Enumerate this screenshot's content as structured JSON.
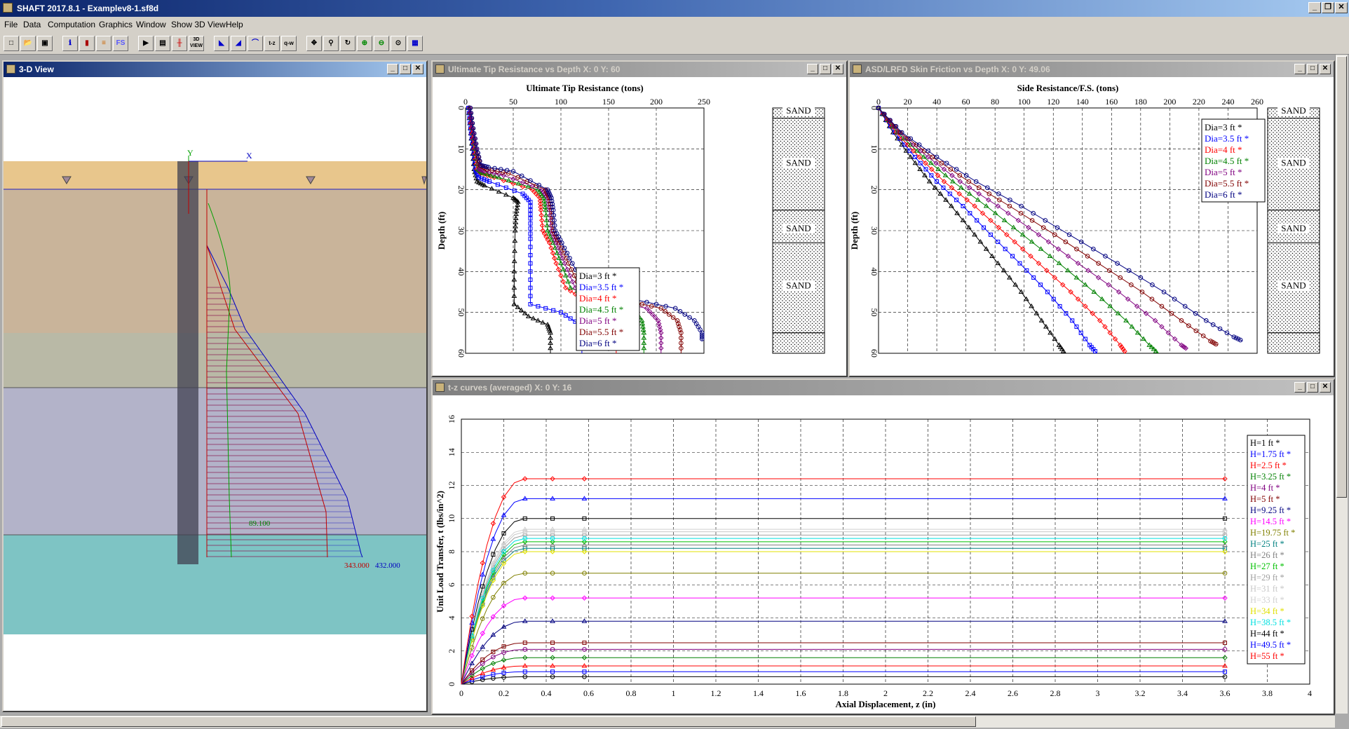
{
  "app": {
    "title": "SHAFT 2017.8.1 - Examplev8-1.sf8d"
  },
  "menu": [
    "File",
    "Data",
    "Computation",
    "Graphics",
    "Window",
    "Show 3D View",
    "Help"
  ],
  "toolbar": {
    "buttons": [
      "new",
      "open",
      "save",
      "color",
      "sep",
      "fs",
      "run",
      "list",
      "pile",
      "3D",
      "icon",
      "icon",
      "icon",
      "icon",
      "t-z",
      "icon",
      "icon",
      "icon",
      "icon",
      "icon",
      "icon",
      "icon",
      "icon"
    ],
    "view3d_label": "3D VIEW",
    "fs_label": "FS"
  },
  "view3d": {
    "title": "3-D View",
    "axis_y": "Y",
    "axis_x": "X",
    "label_mid": "89.100",
    "label_a": "343.000",
    "label_b": "432.000",
    "layers": [
      {
        "color": "#e8c68c"
      },
      {
        "color": "#c9b49a"
      },
      {
        "color": "#b9b9a6"
      },
      {
        "color": "#b3b3c9"
      },
      {
        "color": "#7ec4c4"
      }
    ]
  },
  "tip": {
    "title": "Ultimate Tip Resistance vs Depth X: 0 Y: 60",
    "chart_data": {
      "type": "line",
      "title": "Ultimate Tip Resistance  (tons)",
      "xlabel": "",
      "ylabel": "Depth (ft)",
      "xlim": [
        0,
        250
      ],
      "ylim": [
        0,
        60
      ],
      "xticks": [
        "0",
        "50",
        "100",
        "150",
        "200",
        "250"
      ],
      "yticks": [
        "0",
        "10",
        "20",
        "30",
        "40",
        "50",
        "60"
      ],
      "series": [
        {
          "name": "Dia=3 ft *",
          "color": "#000000",
          "points": [
            [
              3,
              0
            ],
            [
              5,
              5
            ],
            [
              7,
              10
            ],
            [
              9,
              15
            ],
            [
              12,
              18
            ],
            [
              20,
              19
            ],
            [
              50,
              22
            ],
            [
              55,
              23
            ],
            [
              53,
              26
            ],
            [
              52,
              30
            ],
            [
              51,
              40
            ],
            [
              51,
              48
            ],
            [
              66,
              51
            ],
            [
              86,
              53
            ],
            [
              89,
              55
            ],
            [
              89,
              60
            ]
          ]
        },
        {
          "name": "Dia=3.5 ft *",
          "color": "#0000ff",
          "points": [
            [
              3,
              0
            ],
            [
              5,
              5
            ],
            [
              8,
              10
            ],
            [
              10,
              15
            ],
            [
              14,
              17
            ],
            [
              25,
              18
            ],
            [
              60,
              21
            ],
            [
              68,
              23
            ],
            [
              68,
              27
            ],
            [
              68,
              32
            ],
            [
              68,
              40
            ],
            [
              68,
              48
            ],
            [
              100,
              50
            ],
            [
              120,
              53
            ],
            [
              122,
              55
            ],
            [
              122,
              60
            ]
          ]
        },
        {
          "name": "Dia=4 ft *",
          "color": "#ff0000",
          "points": [
            [
              4,
              0
            ],
            [
              6,
              5
            ],
            [
              9,
              10
            ],
            [
              12,
              15
            ],
            [
              16,
              16
            ],
            [
              30,
              17
            ],
            [
              70,
              20
            ],
            [
              78,
              22
            ],
            [
              79,
              25
            ],
            [
              81,
              30
            ],
            [
              88,
              33
            ],
            [
              95,
              38
            ],
            [
              105,
              44
            ],
            [
              125,
              47
            ],
            [
              150,
              49
            ],
            [
              157,
              52
            ],
            [
              158,
              55
            ],
            [
              158,
              60
            ]
          ]
        },
        {
          "name": "Dia=4.5 ft *",
          "color": "#008000",
          "points": [
            [
              4,
              0
            ],
            [
              7,
              5
            ],
            [
              10,
              10
            ],
            [
              13,
              15
            ],
            [
              18,
              16
            ],
            [
              35,
              17
            ],
            [
              76,
              20
            ],
            [
              82,
              22
            ],
            [
              84,
              25
            ],
            [
              86,
              30
            ],
            [
              92,
              33
            ],
            [
              100,
              38
            ],
            [
              110,
              44
            ],
            [
              140,
              47
            ],
            [
              175,
              49
            ],
            [
              185,
              52
            ],
            [
              187,
              55
            ],
            [
              187,
              60
            ]
          ]
        },
        {
          "name": "Dia=5 ft *",
          "color": "#800080",
          "points": [
            [
              4,
              0
            ],
            [
              7,
              5
            ],
            [
              11,
              10
            ],
            [
              14,
              15
            ],
            [
              20,
              15.5
            ],
            [
              40,
              16.5
            ],
            [
              80,
              20
            ],
            [
              86,
              22
            ],
            [
              88,
              25
            ],
            [
              90,
              30
            ],
            [
              95,
              33
            ],
            [
              104,
              38
            ],
            [
              115,
              44
            ],
            [
              150,
              47
            ],
            [
              190,
              49
            ],
            [
              202,
              52
            ],
            [
              205,
              55
            ],
            [
              205,
              60
            ]
          ]
        },
        {
          "name": "Dia=5.5 ft *",
          "color": "#800000",
          "points": [
            [
              5,
              0
            ],
            [
              8,
              5
            ],
            [
              12,
              10
            ],
            [
              15,
              14
            ],
            [
              22,
              15
            ],
            [
              45,
              16
            ],
            [
              84,
              20
            ],
            [
              88,
              22
            ],
            [
              90,
              25
            ],
            [
              92,
              30
            ],
            [
              98,
              33
            ],
            [
              108,
              38
            ],
            [
              120,
              44
            ],
            [
              165,
              47
            ],
            [
              205,
              49
            ],
            [
              222,
              52
            ],
            [
              226,
              55
            ],
            [
              226,
              60
            ]
          ]
        },
        {
          "name": "Dia=6 ft *",
          "color": "#000080",
          "points": [
            [
              5,
              0
            ],
            [
              8,
              5
            ],
            [
              12,
              10
            ],
            [
              16,
              14
            ],
            [
              24,
              14.5
            ],
            [
              50,
              15.5
            ],
            [
              86,
              20
            ],
            [
              90,
              22
            ],
            [
              92,
              25
            ],
            [
              94,
              30
            ],
            [
              101,
              33
            ],
            [
              112,
              38
            ],
            [
              126,
              44
            ],
            [
              180,
              47
            ],
            [
              220,
              49
            ],
            [
              240,
              52
            ],
            [
              248,
              55
            ],
            [
              248,
              57
            ]
          ]
        }
      ]
    },
    "soil": [
      "SAND",
      "SAND",
      "SAND",
      "SAND"
    ]
  },
  "skin": {
    "title": "ASD/LRFD Skin Friction vs Depth  X: 0 Y: 49.06",
    "chart_data": {
      "type": "line",
      "title": "Side Resistance/F.S.  (tons)",
      "xlabel": "",
      "ylabel": "Depth (ft)",
      "xlim": [
        0,
        260
      ],
      "ylim": [
        0,
        60
      ],
      "xticks": [
        "0",
        "20",
        "40",
        "60",
        "80",
        "100",
        "120",
        "140",
        "160",
        "180",
        "200",
        "220",
        "240",
        "260"
      ],
      "yticks": [
        "0",
        "10",
        "20",
        "30",
        "40",
        "50",
        "60"
      ],
      "series": [
        {
          "name": "Dia=3 ft *",
          "color": "#000000",
          "points": [
            [
              0,
              0
            ],
            [
              10,
              6
            ],
            [
              22,
              12
            ],
            [
              35,
              18
            ],
            [
              50,
              24
            ],
            [
              66,
              31
            ],
            [
              82,
              38
            ],
            [
              98,
              45
            ],
            [
              112,
              52
            ],
            [
              124,
              58
            ],
            [
              128,
              60
            ]
          ]
        },
        {
          "name": "Dia=3.5 ft *",
          "color": "#0000ff",
          "points": [
            [
              0,
              0
            ],
            [
              11,
              6
            ],
            [
              25,
              12
            ],
            [
              40,
              18
            ],
            [
              58,
              24
            ],
            [
              77,
              31
            ],
            [
              97,
              38
            ],
            [
              116,
              45
            ],
            [
              133,
              52
            ],
            [
              145,
              58
            ],
            [
              150,
              60
            ]
          ]
        },
        {
          "name": "Dia=4 ft *",
          "color": "#ff0000",
          "points": [
            [
              0,
              0
            ],
            [
              12,
              6
            ],
            [
              28,
              12
            ],
            [
              45,
              18
            ],
            [
              66,
              24
            ],
            [
              88,
              31
            ],
            [
              110,
              38
            ],
            [
              132,
              45
            ],
            [
              152,
              52
            ],
            [
              166,
              58
            ],
            [
              170,
              60
            ]
          ]
        },
        {
          "name": "Dia=4.5 ft *",
          "color": "#008000",
          "points": [
            [
              0,
              0
            ],
            [
              13,
              6
            ],
            [
              31,
              12
            ],
            [
              51,
              18
            ],
            [
              74,
              24
            ],
            [
              99,
              31
            ],
            [
              124,
              38
            ],
            [
              148,
              45
            ],
            [
              170,
              52
            ],
            [
              186,
              58
            ],
            [
              192,
              60
            ]
          ]
        },
        {
          "name": "Dia=5 ft *",
          "color": "#800080",
          "points": [
            [
              0,
              0
            ],
            [
              14,
              6
            ],
            [
              34,
              12
            ],
            [
              56,
              18
            ],
            [
              82,
              24
            ],
            [
              110,
              31
            ],
            [
              137,
              38
            ],
            [
              165,
              45
            ],
            [
              190,
              52
            ],
            [
              208,
              58
            ],
            [
              212,
              59
            ]
          ]
        },
        {
          "name": "Dia=5.5 ft *",
          "color": "#800000",
          "points": [
            [
              0,
              0
            ],
            [
              15,
              6
            ],
            [
              37,
              12
            ],
            [
              62,
              18
            ],
            [
              90,
              24
            ],
            [
              121,
              31
            ],
            [
              151,
              38
            ],
            [
              181,
              45
            ],
            [
              208,
              52
            ],
            [
              228,
              57
            ],
            [
              233,
              58
            ]
          ]
        },
        {
          "name": "Dia=6 ft *",
          "color": "#000080",
          "points": [
            [
              0,
              0
            ],
            [
              16,
              6
            ],
            [
              40,
              12
            ],
            [
              67,
              18
            ],
            [
              98,
              24
            ],
            [
              131,
              31
            ],
            [
              164,
              38
            ],
            [
              196,
              45
            ],
            [
              225,
              52
            ],
            [
              244,
              56
            ],
            [
              250,
              57
            ]
          ]
        }
      ]
    },
    "soil": [
      "SAND",
      "SAND",
      "SAND",
      "SAND"
    ]
  },
  "tz": {
    "title": "t-z curves (averaged) X: 0 Y: 16",
    "chart_data": {
      "type": "line",
      "title": "",
      "xlabel": "Axial Displacement, z (in)",
      "ylabel": "Unit Load Transfer, t (lbs/in^2)",
      "xlim": [
        0,
        4
      ],
      "ylim": [
        0,
        16
      ],
      "xticks": [
        "0",
        "0.2",
        "0.4",
        "0.6",
        "0.8",
        "1",
        "1.2",
        "1.4",
        "1.6",
        "1.8",
        "2",
        "2.2",
        "2.4",
        "2.6",
        "2.8",
        "3",
        "3.2",
        "3.4",
        "3.6",
        "3.8",
        "4"
      ],
      "yticks": [
        "0",
        "2",
        "4",
        "6",
        "8",
        "10",
        "12",
        "14",
        "16"
      ],
      "series": [
        {
          "name": "H=1 ft *",
          "color": "#000000",
          "plateau": 0.45
        },
        {
          "name": "H=1.75 ft *",
          "color": "#0000ff",
          "plateau": 0.75
        },
        {
          "name": "H=2.5 ft *",
          "color": "#ff0000",
          "plateau": 1.1
        },
        {
          "name": "H=3.25 ft *",
          "color": "#008000",
          "plateau": 1.6
        },
        {
          "name": "H=4 ft *",
          "color": "#800080",
          "plateau": 2.1
        },
        {
          "name": "H=5 ft *",
          "color": "#800000",
          "plateau": 2.5
        },
        {
          "name": "H=9.25 ft *",
          "color": "#000080",
          "plateau": 3.8
        },
        {
          "name": "H=14.5 ft *",
          "color": "#ff00ff",
          "plateau": 5.2
        },
        {
          "name": "H=19.75 ft *",
          "color": "#808000",
          "plateau": 6.7
        },
        {
          "name": "H=25 ft *",
          "color": "#008080",
          "plateau": 8.2
        },
        {
          "name": "H=26 ft *",
          "color": "#808080",
          "plateau": 8.4
        },
        {
          "name": "H=27 ft *",
          "color": "#00c000",
          "plateau": 8.6
        },
        {
          "name": "H=29 ft *",
          "color": "#a0a0a0",
          "plateau": 9.0
        },
        {
          "name": "H=31 ft *",
          "color": "#c8c8c8",
          "plateau": 9.2
        },
        {
          "name": "H=33 ft *",
          "color": "#d0d0d0",
          "plateau": 9.35
        },
        {
          "name": "H=34 ft *",
          "color": "#e0e000",
          "plateau": 8.0
        },
        {
          "name": "H=38.5 ft *",
          "color": "#00e0e0",
          "plateau": 8.8
        },
        {
          "name": "H=44 ft *",
          "color": "#000000",
          "plateau": 10.0
        },
        {
          "name": "H=49.5 ft *",
          "color": "#0000ff",
          "plateau": 11.2
        },
        {
          "name": "H=55 ft *",
          "color": "#ff0000",
          "plateau": 12.4
        }
      ]
    }
  }
}
